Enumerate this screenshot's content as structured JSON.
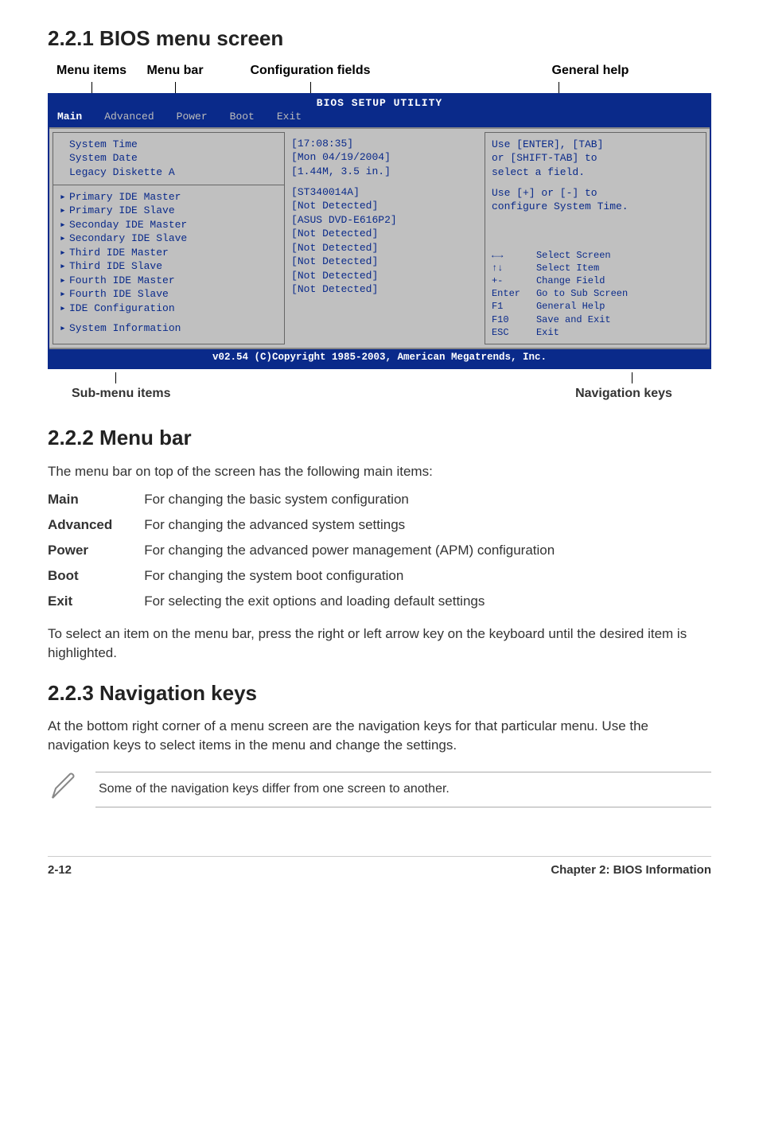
{
  "sections": {
    "s1_heading": "2.2.1   BIOS menu screen",
    "s2_heading": "2.2.2   Menu bar",
    "s3_heading": "2.2.3   Navigation keys"
  },
  "fig_labels": {
    "menu_items": "Menu items",
    "menu_bar": "Menu bar",
    "config_fields": "Configuration fields",
    "general_help": "General help",
    "sub_menu": "Sub-menu items",
    "nav_keys": "Navigation keys"
  },
  "bios": {
    "title": "BIOS SETUP UTILITY",
    "menubar": [
      "Main",
      "Advanced",
      "Power",
      "Boot",
      "Exit"
    ],
    "left_top": [
      "System Time",
      "System Date",
      "Legacy Diskette A"
    ],
    "left_sub": [
      "Primary IDE Master",
      "Primary IDE Slave",
      "Seconday IDE Master",
      "Secondary IDE Slave",
      "Third IDE Master",
      "Third IDE Slave",
      "Fourth IDE Master",
      "Fourth IDE Slave",
      "IDE Configuration"
    ],
    "left_bottom": "System Information",
    "mid_top": [
      "[17:08:35]",
      "[Mon 04/19/2004]",
      "[1.44M, 3.5 in.]"
    ],
    "mid_sub": [
      "[ST340014A]",
      "[Not Detected]",
      "[ASUS DVD-E616P2]",
      "[Not Detected]",
      "[Not Detected]",
      "[Not Detected]",
      "[Not Detected]",
      "[Not Detected]"
    ],
    "help_top": [
      "Use [ENTER], [TAB]",
      "or [SHIFT-TAB] to",
      "select a field.",
      "",
      "Use [+] or [-] to",
      "configure System Time."
    ],
    "help_keys": [
      {
        "k": "←→",
        "d": "Select Screen"
      },
      {
        "k": "↑↓",
        "d": "Select Item"
      },
      {
        "k": "+-",
        "d": "Change Field"
      },
      {
        "k": "Enter",
        "d": "Go to Sub Screen"
      },
      {
        "k": "F1",
        "d": "General Help"
      },
      {
        "k": "F10",
        "d": "Save and Exit"
      },
      {
        "k": "ESC",
        "d": "Exit"
      }
    ],
    "footer": "v02.54 (C)Copyright 1985-2003, American Megatrends, Inc."
  },
  "menubar_text": {
    "intro": "The menu bar on top of the screen has the following main items:",
    "defs": [
      {
        "term": "Main",
        "desc": "For changing the basic system configuration"
      },
      {
        "term": "Advanced",
        "desc": "For changing the advanced system settings"
      },
      {
        "term": "Power",
        "desc": "For changing the advanced power management (APM) configuration"
      },
      {
        "term": "Boot",
        "desc": "For changing the system boot configuration"
      },
      {
        "term": "Exit",
        "desc": "For selecting the exit options and loading default settings"
      }
    ],
    "outro": "To select an item on the menu bar, press the right or left arrow key on the keyboard until the desired item is highlighted."
  },
  "navkeys_text": "At the bottom right corner of a menu screen are the navigation keys for that particular menu. Use the navigation keys to select items in the menu and change the settings.",
  "note_text": "Some of the navigation keys differ from one screen to another.",
  "footer": {
    "left": "2-12",
    "right": "Chapter 2: BIOS Information"
  }
}
